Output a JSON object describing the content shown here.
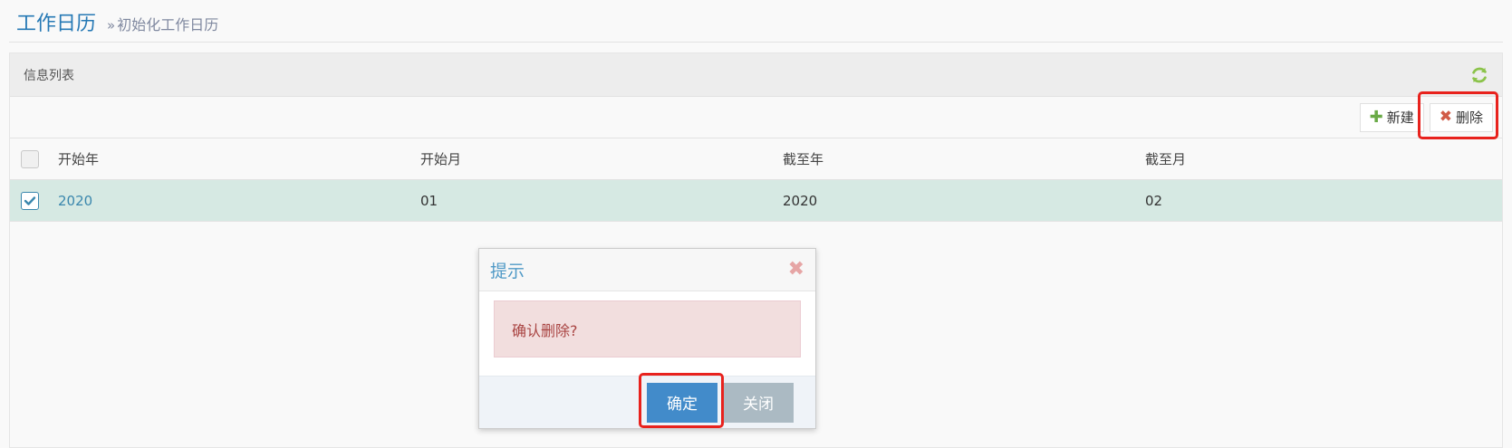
{
  "header": {
    "title": "工作日历",
    "breadcrumb_chevron": "»",
    "breadcrumb": "初始化工作日历"
  },
  "panel": {
    "title": "信息列表",
    "refresh_icon": "refresh-icon"
  },
  "toolbar": {
    "new_label": "新建",
    "delete_label": "删除"
  },
  "table": {
    "columns": [
      "开始年",
      "开始月",
      "截至年",
      "截至月"
    ],
    "rows": [
      {
        "selected": true,
        "cells": [
          "2020",
          "01",
          "2020",
          "02"
        ]
      }
    ]
  },
  "dialog": {
    "title": "提示",
    "message": "确认删除?",
    "confirm_label": "确定",
    "close_label": "关闭"
  },
  "colors": {
    "title_blue": "#2679b5",
    "selected_row": "#d6e9e3",
    "primary_button": "#428bca",
    "secondary_button": "#abbac3",
    "alert_bg": "#f2dede",
    "alert_text": "#a94442",
    "highlight_box": "#e8221d"
  }
}
